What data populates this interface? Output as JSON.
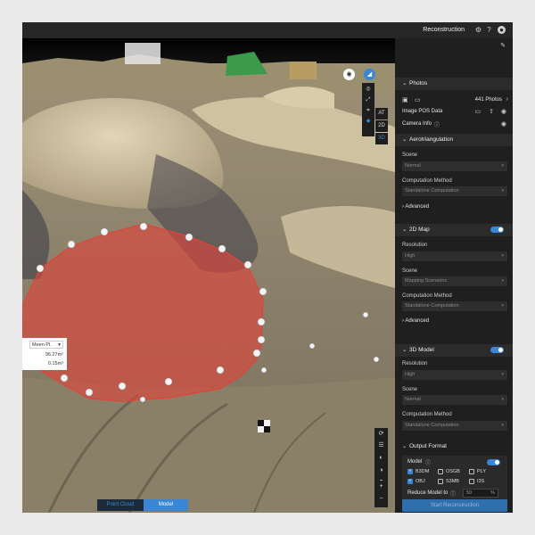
{
  "topbar": {
    "title": "Reconstruction",
    "icons": [
      "gear-icon",
      "help-icon",
      "user-avatar-icon"
    ]
  },
  "photos": {
    "header": "Photos",
    "count_label": "441 Photos",
    "pos_label": "Image POS Data",
    "camera_label": "Camera Info"
  },
  "aerotriangulation": {
    "header": "Aerotriangulation",
    "scene_label": "Scene",
    "scene_value": "Normal",
    "method_label": "Computation Method",
    "method_value": "Standalone Computation",
    "advanced_label": "Advanced"
  },
  "map2d": {
    "header": "2D Map",
    "toggle_on": true,
    "resolution_label": "Resolution",
    "resolution_value": "High",
    "scene_label": "Scene",
    "scene_value": "Mapping Scenarios",
    "method_label": "Computation Method",
    "method_value": "Standalone Computation",
    "advanced_label": "Advanced"
  },
  "model3d": {
    "header": "3D Model",
    "toggle_on": true,
    "resolution_label": "Resolution",
    "resolution_value": "High",
    "scene_label": "Scene",
    "scene_value": "Normal",
    "method_label": "Computation Method",
    "method_value": "Standalone Computation"
  },
  "output": {
    "header": "Output Format",
    "model_label": "Model",
    "formats": [
      {
        "label": "B3DM",
        "checked": true
      },
      {
        "label": "OSGB",
        "checked": false
      },
      {
        "label": "PLY",
        "checked": false
      },
      {
        "label": "OBJ",
        "checked": true
      },
      {
        "label": "S3MB",
        "checked": false
      },
      {
        "label": "I3S",
        "checked": false
      }
    ],
    "reduce_label": "Reduce Model to",
    "reduce_value": "50",
    "reduce_unit": "%"
  },
  "start_button": "Start Reconstruction",
  "viewport": {
    "side_tools": [
      "AT",
      "2D",
      "3D"
    ],
    "view_toggle": {
      "left": "Point Cloud",
      "right": "Model",
      "active": "Model"
    },
    "zoom_in": "+",
    "zoom_out": "−",
    "measure": {
      "mode": "Meen Pl.",
      "area": "96.27m²",
      "volume": "0.15m³"
    }
  },
  "colors": {
    "accent": "#3a86d4",
    "polygon_fill": "#e0433a",
    "panel_bg": "#1f1f1f"
  }
}
